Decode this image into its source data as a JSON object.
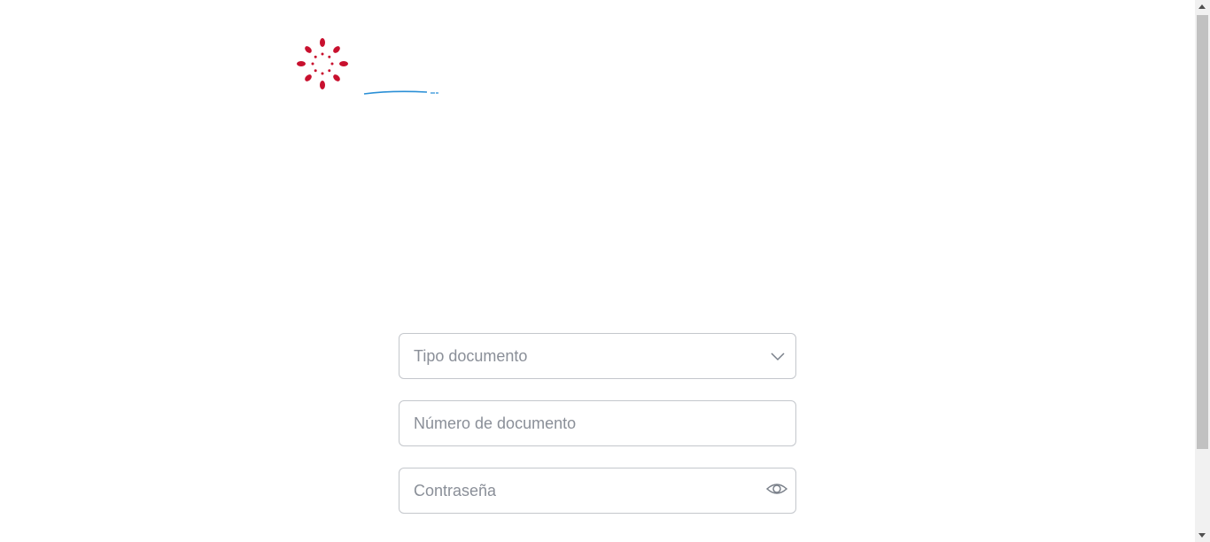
{
  "form": {
    "document_type": {
      "placeholder": "Tipo documento"
    },
    "document_number": {
      "placeholder": "Número de documento"
    },
    "password": {
      "placeholder": "Contraseña"
    }
  },
  "icons": {
    "logo": "flower-burst-logo",
    "select_caret": "chevron-down-icon",
    "password_toggle": "eye-icon"
  },
  "colors": {
    "logo_red": "#c8102e",
    "logo_blue": "#2a8fd6",
    "field_border": "#c4c7cc",
    "placeholder": "#8a8f98",
    "icon": "#7a808a"
  }
}
